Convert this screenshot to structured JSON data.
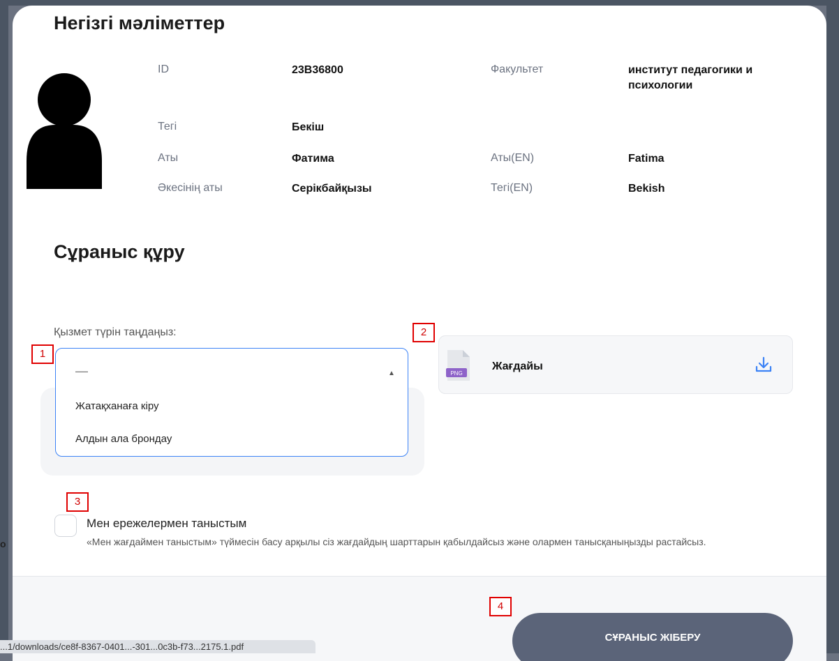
{
  "info": {
    "title": "Негізгі мәліметтер",
    "fields": [
      {
        "label": "ID",
        "value": "23В36800"
      },
      {
        "label": "Факультет",
        "value": "институт педагогики и психологии"
      },
      {
        "label": "Тегі",
        "value": "Бекіш"
      },
      {
        "label": "Аты",
        "value": "Фатима"
      },
      {
        "label": "Аты(EN)",
        "value": "Fatima"
      },
      {
        "label": "Әкесінің аты",
        "value": "Серікбайқызы"
      },
      {
        "label": "Тегі(EN)",
        "value": "Bekish"
      }
    ]
  },
  "request": {
    "title": "Сұраныс құру",
    "select_label": "Қызмет түрін таңдаңыз:",
    "selected_value": "—",
    "options": [
      "Жатақханаға кіру",
      "Алдын ала брондау"
    ],
    "file": {
      "name": "Жағдайы",
      "badge": "PNG"
    },
    "checkbox_title": "Мен ережелермен таныстым",
    "checkbox_desc": "«Мен жағдаймен таныстым» түймесін басу арқылы сіз жағдайдың шарттарын қабылдайсыз және олармен танысқаныңызды растайсыз.",
    "submit": "СҰРАНЫС ЖІБЕРУ"
  },
  "markers": [
    "1",
    "2",
    "3",
    "4"
  ],
  "behind_text": "o",
  "statusbar_text": "...1/downloads/ce8f-8367-0401...-301...0c3b-f73...2175.1.pdf",
  "colors": {
    "accent": "#3b82f6",
    "submit": "#5b6479",
    "marker": "#e00000"
  }
}
